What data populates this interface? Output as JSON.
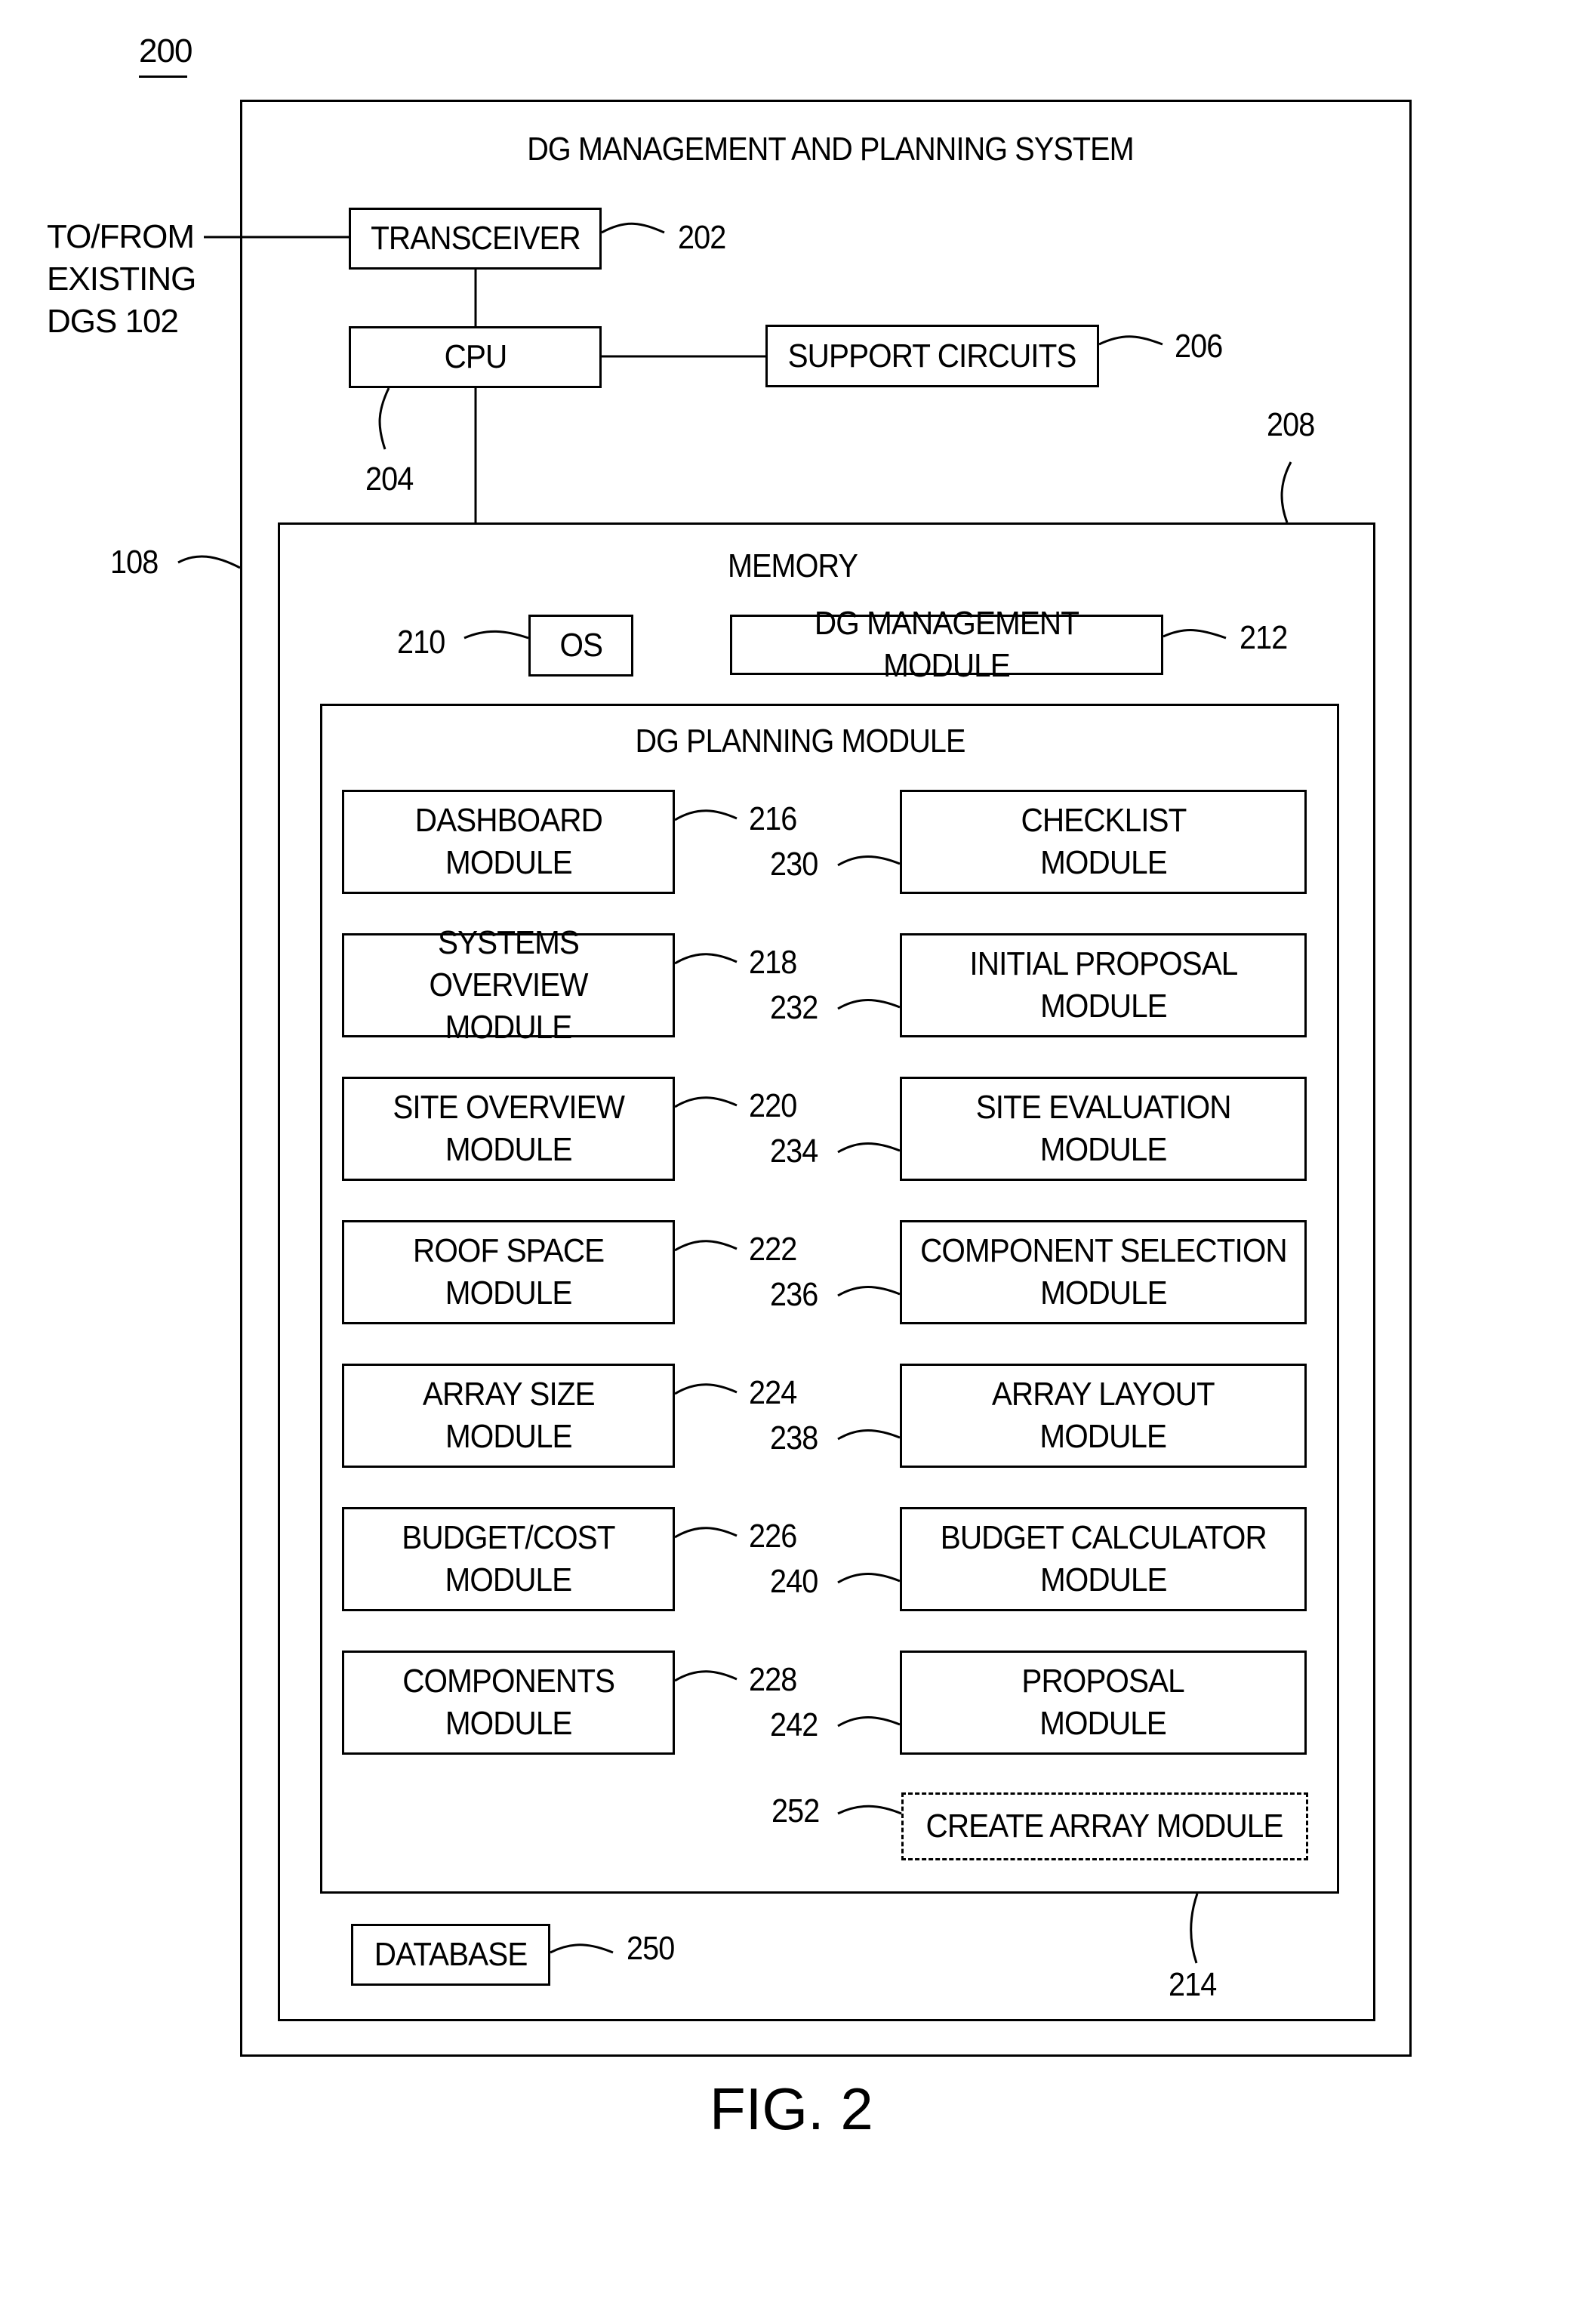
{
  "figure": {
    "number_label": "200",
    "caption": "FIG. 2"
  },
  "system": {
    "title": "DG MANAGEMENT AND PLANNING SYSTEM",
    "ref": "108",
    "external": {
      "label": "TO/FROM\nEXISTING\nDGS  102"
    },
    "transceiver": {
      "label": "TRANSCEIVER",
      "ref": "202"
    },
    "cpu": {
      "label": "CPU",
      "ref": "204"
    },
    "support_circuits": {
      "label": "SUPPORT CIRCUITS",
      "ref": "206"
    }
  },
  "memory": {
    "title": "MEMORY",
    "ref": "208",
    "os": {
      "label": "OS",
      "ref": "210"
    },
    "dg_management_module": {
      "label": "DG MANAGEMENT MODULE",
      "ref": "212"
    },
    "database": {
      "label": "DATABASE",
      "ref": "250"
    }
  },
  "planning_module": {
    "title": "DG PLANNING MODULE",
    "ref": "214",
    "left_modules": [
      {
        "label": "DASHBOARD\nMODULE",
        "ref": "216"
      },
      {
        "label": "SYSTEMS OVERVIEW\nMODULE",
        "ref": "218"
      },
      {
        "label": "SITE OVERVIEW\nMODULE",
        "ref": "220"
      },
      {
        "label": "ROOF SPACE\nMODULE",
        "ref": "222"
      },
      {
        "label": "ARRAY SIZE\nMODULE",
        "ref": "224"
      },
      {
        "label": "BUDGET/COST\nMODULE",
        "ref": "226"
      },
      {
        "label": "COMPONENTS\nMODULE",
        "ref": "228"
      }
    ],
    "right_modules": [
      {
        "label": "CHECKLIST\nMODULE",
        "ref": "230"
      },
      {
        "label": "INITIAL PROPOSAL\nMODULE",
        "ref": "232"
      },
      {
        "label": "SITE EVALUATION\nMODULE",
        "ref": "234"
      },
      {
        "label": "COMPONENT SELECTION\nMODULE",
        "ref": "236"
      },
      {
        "label": "ARRAY LAYOUT\nMODULE",
        "ref": "238"
      },
      {
        "label": "BUDGET CALCULATOR\nMODULE",
        "ref": "240"
      },
      {
        "label": "PROPOSAL\nMODULE",
        "ref": "242"
      }
    ],
    "optional_module": {
      "label": "CREATE ARRAY MODULE",
      "ref": "252",
      "style": "dashed"
    }
  }
}
